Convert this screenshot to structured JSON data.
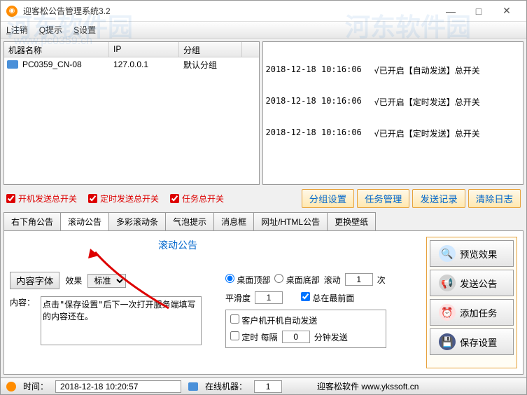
{
  "window": {
    "title": "迎客松公告管理系统3.2"
  },
  "menu": {
    "logout": "注销",
    "prompt": "提示",
    "setting": "设置",
    "logout_u": "L",
    "prompt_u": "Q",
    "setting_u": "S"
  },
  "watermark": {
    "brand": "河东软件园",
    "url": "www.pc0359.cn"
  },
  "list": {
    "headers": {
      "name": "机器名称",
      "ip": "IP",
      "group": "分组"
    },
    "row": {
      "name": "PC0359_CN-08",
      "ip": "127.0.0.1",
      "group": "默认分组"
    }
  },
  "log": [
    {
      "time": "2018-12-18 10:16:06",
      "msg": "√已开启【自动发送】总开关"
    },
    {
      "time": "2018-12-18 10:16:06",
      "msg": "√已开启【定时发送】总开关"
    },
    {
      "time": "2018-12-18 10:16:06",
      "msg": "√已开启【定时发送】总开关"
    }
  ],
  "switches": {
    "boot": "开机发送总开关",
    "timed": "定时发送总开关",
    "task": "任务总开关"
  },
  "buttons": {
    "group": "分组设置",
    "task": "任务管理",
    "record": "发送记录",
    "clear": "清除日志"
  },
  "tabs": {
    "corner": "右下角公告",
    "scroll": "滚动公告",
    "multi": "多彩滚动条",
    "bubble": "气泡提示",
    "msgbox": "消息框",
    "html": "网址/HTML公告",
    "wallpaper": "更换壁纸"
  },
  "scroll_panel": {
    "title": "滚动公告",
    "font_btn": "内容字体",
    "effect_label": "效果",
    "effect_value": "标准",
    "content_label": "内容：",
    "content_value": "点击\"保存设置\"后下一次打开服务端填写的内容还在。",
    "desktop_top": "桌面顶部",
    "desktop_bottom": "桌面底部",
    "scroll_label": "滚动",
    "scroll_times": "1",
    "times_suffix": "次",
    "smooth_label": "平滑度",
    "smooth_value": "1",
    "always_front": "总在最前面",
    "client_boot": "客户机开机自动发送",
    "timed_label": "定时   每隔",
    "timed_value": "0",
    "timed_suffix": "分钟发送"
  },
  "bigbtns": {
    "preview": "预览效果",
    "send": "发送公告",
    "task": "添加任务",
    "save": "保存设置"
  },
  "status": {
    "time_label": "时间：",
    "time_value": "2018-12-18 10:20:57",
    "online_label": "在线机器：",
    "online_value": "1",
    "brand": "迎客松软件 www.ykssoft.cn"
  }
}
